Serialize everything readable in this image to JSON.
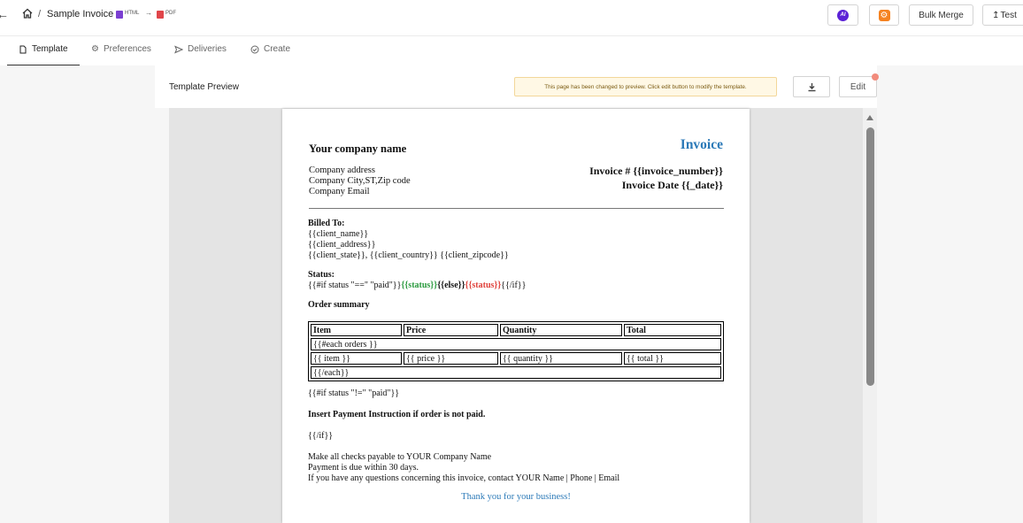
{
  "header": {
    "back_icon": "arrow-left-icon",
    "home_icon": "home-icon",
    "separator": "/",
    "title": "Sample Invoice",
    "format_from": "HTML",
    "format_arrow": "→",
    "format_to": "PDF",
    "ai_label": "AI",
    "bulk_merge_label": "Bulk Merge",
    "test_label": "Test",
    "test_icon": "upload-icon"
  },
  "tabs": [
    {
      "label": "Template",
      "icon": "file-icon",
      "active": true
    },
    {
      "label": "Preferences",
      "icon": "gear-icon",
      "active": false
    },
    {
      "label": "Deliveries",
      "icon": "send-icon",
      "active": false
    },
    {
      "label": "Create",
      "icon": "check-circle-icon",
      "active": false
    }
  ],
  "preview": {
    "title": "Template Preview",
    "notice": "This page has been changed to preview. Click edit button to modify the template.",
    "download_icon": "download-icon",
    "edit_label": "Edit"
  },
  "invoice": {
    "company_name": "Your company name",
    "heading": "Invoice",
    "company_address": "Company address",
    "company_city": "Company City,ST,Zip code",
    "company_email": "Company Email",
    "invoice_number": "Invoice # {{invoice_number}}",
    "invoice_date": "Invoice Date {{_date}}",
    "billed_to_label": "Billed To:",
    "client_name": "{{client_name}}",
    "client_address": "{{client_address}}",
    "client_location": "{{client_state}}, {{client_country}} {{client_zipcode}}",
    "status_label": "Status:",
    "status_if": "{{#if status \"==\" \"paid\"}}",
    "status_paid": "{{status}}",
    "status_else": "{{else}}",
    "status_unpaid": "{{status}}",
    "status_endif": "{{/if}}",
    "order_summary_label": "Order summary",
    "table": {
      "headers": [
        "Item",
        "Price",
        "Quantity",
        "Total"
      ],
      "each_open": "{{#each orders }}",
      "row": [
        "{{ item }}",
        "{{ price }}",
        "{{ quantity }}",
        "{{ total }}"
      ],
      "each_close": "{{/each}}"
    },
    "unpaid_if": "{{#if status \"!=\" \"paid\"}}",
    "payment_instruction": "Insert Payment Instruction if order is not paid.",
    "unpaid_endif": "{{/if}}",
    "footer_line1": "Make all checks payable to YOUR Company Name",
    "footer_line2": "Payment is due within 30 days.",
    "footer_line3": "If you have any questions concerning this invoice, contact YOUR Name | Phone | Email",
    "thanks": "Thank you for your business!"
  },
  "colors": {
    "accent_blue": "#2c7ab8",
    "status_green": "#2a9a3e",
    "status_red": "#e0403a",
    "ai_purple": "#5b21d6",
    "gear_orange": "#f58220"
  }
}
